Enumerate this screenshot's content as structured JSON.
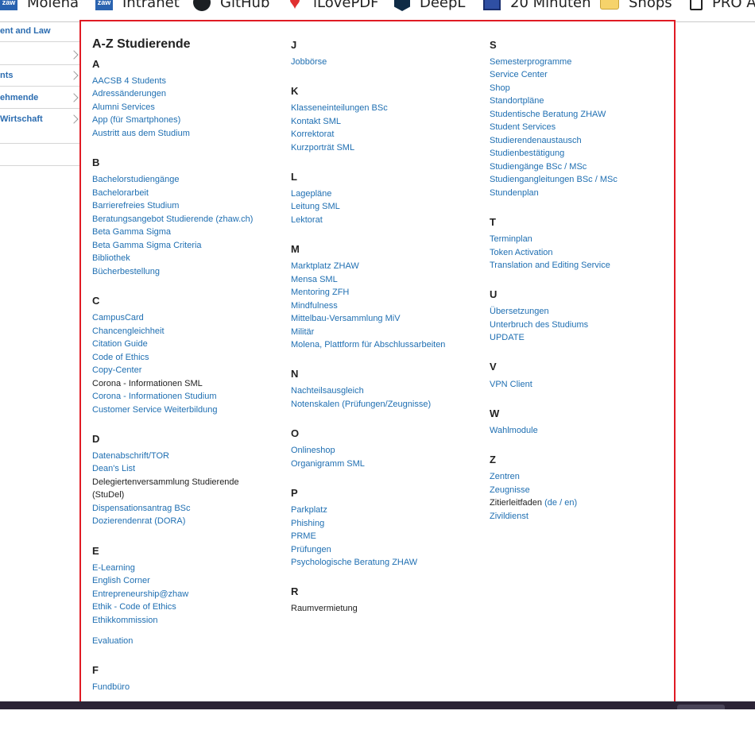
{
  "bookmarks": [
    {
      "label": "Molena",
      "icon": "zhaw-logo-icon"
    },
    {
      "label": "Intranet",
      "icon": "zhaw-logo-icon"
    },
    {
      "label": "GitHub",
      "icon": "github-icon"
    },
    {
      "label": "iLovePDF",
      "icon": "heart-icon"
    },
    {
      "label": "DeepL",
      "icon": "deepl-icon"
    },
    {
      "label": "20 Minuten",
      "icon": "20min-icon"
    },
    {
      "label": "Shops",
      "icon": "folder-icon"
    },
    {
      "label": "PRO A",
      "icon": "page-icon"
    }
  ],
  "sidenav": {
    "items": [
      "ent and Law",
      "",
      "nts",
      "ehmende",
      "Wirtschaft"
    ]
  },
  "az": {
    "title": "A-Z Studierende",
    "sections": {
      "A": {
        "letter": "A",
        "items": [
          "AACSB 4 Students",
          "Adressänderungen",
          "Alumni Services",
          "App (für Smartphones)",
          "Austritt aus dem Studium"
        ]
      },
      "B": {
        "letter": "B",
        "items": [
          "Bachelorstudiengänge",
          "Bachelorarbeit",
          "Barrierefreies Studium",
          "Beratungsangebot Studierende (zhaw.ch)",
          "Beta Gamma Sigma",
          "Beta Gamma Sigma Criteria",
          "Bibliothek",
          "Bücherbestellung"
        ]
      },
      "C": {
        "letter": "C",
        "items": [
          "CampusCard",
          "Chancengleichheit",
          "Citation Guide",
          "Code of Ethics",
          "Copy-Center",
          "Corona - Informationen SML",
          "Corona - Informationen Studium",
          "Customer Service Weiterbildung"
        ]
      },
      "D": {
        "letter": "D",
        "items": [
          "Datenabschrift/TOR",
          "Dean's List",
          "Delegiertenversammlung Studierende",
          "(StuDel)",
          "Dispensationsantrag BSc",
          "Dozierendenrat (DORA)"
        ]
      },
      "E": {
        "letter": "E",
        "items": [
          "E-Learning",
          "English Corner",
          "Entrepreneurship@zhaw",
          "Ethik - Code of Ethics",
          "Ethikkommission",
          "Evaluation"
        ]
      },
      "F": {
        "letter": "F",
        "items": [
          "Fundbüro"
        ]
      },
      "J": {
        "letter": "J",
        "items": [
          "Jobbörse"
        ]
      },
      "K": {
        "letter": "K",
        "items": [
          "Klasseneinteilungen BSc",
          "Kontakt SML",
          "Korrektorat",
          "Kurzporträt SML"
        ]
      },
      "L": {
        "letter": "L",
        "items": [
          "Lagepläne",
          "Leitung SML",
          "Lektorat"
        ]
      },
      "M": {
        "letter": "M",
        "items": [
          "Marktplatz ZHAW",
          "Mensa SML",
          "Mentoring ZFH",
          "Mindfulness",
          "Mittelbau-Versammlung MiV",
          "Militär",
          "Molena, Plattform für Abschlussarbeiten"
        ]
      },
      "N": {
        "letter": "N",
        "items": [
          "Nachteilsausgleich",
          "Notenskalen (Prüfungen/Zeugnisse)"
        ]
      },
      "O": {
        "letter": "O",
        "items": [
          "Onlineshop",
          "Organigramm SML"
        ]
      },
      "P": {
        "letter": "P",
        "items": [
          "Parkplatz",
          "Phishing",
          "PRME",
          "Prüfungen",
          "Psychologische Beratung ZHAW"
        ]
      },
      "R": {
        "letter": "R",
        "items": [
          "Raumvermietung"
        ]
      },
      "S": {
        "letter": "S",
        "items": [
          "Semesterprogramme",
          "Service Center",
          "Shop",
          "Standortpläne",
          "Studentische Beratung ZHAW",
          "Student Services",
          "Studierendenaustausch",
          "Studienbestätigung",
          "Studiengänge BSc / MSc",
          "Studiengangleitungen BSc / MSc",
          "Stundenplan"
        ]
      },
      "T": {
        "letter": "T",
        "items": [
          "Terminplan",
          "Token Activation",
          "Translation and Editing Service"
        ]
      },
      "U": {
        "letter": "U",
        "items": [
          "Übersetzungen",
          "Unterbruch des Studiums",
          "UPDATE"
        ]
      },
      "V": {
        "letter": "V",
        "items": [
          "VPN Client"
        ]
      },
      "W": {
        "letter": "W",
        "items": [
          "Wahlmodule"
        ]
      },
      "Z": {
        "letter": "Z",
        "items": [
          "Zentren",
          "Zeugnisse",
          "Zitierleitfaden",
          "de",
          "en",
          "Zivildienst"
        ]
      }
    }
  },
  "colors": {
    "link": "#1f6fb2",
    "highlight_border": "#e01b24",
    "text": "#222222"
  }
}
